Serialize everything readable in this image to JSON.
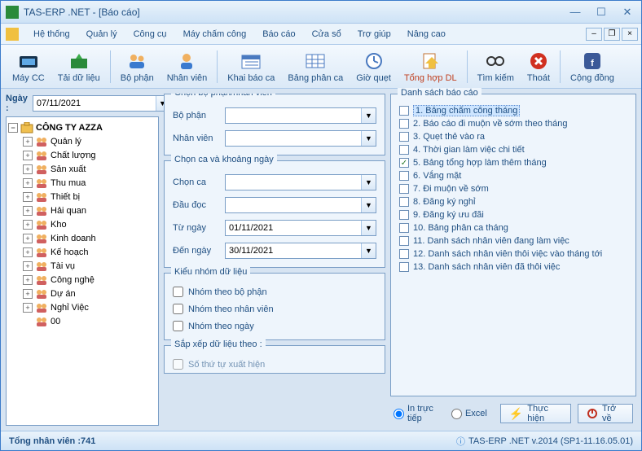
{
  "title": "TAS-ERP .NET - [Báo cáo]",
  "menu": {
    "items": [
      "Hệ thống",
      "Quản lý",
      "Công cụ",
      "Máy chấm công",
      "Báo cáo",
      "Cửa sổ",
      "Trợ giúp",
      "Nâng cao"
    ]
  },
  "toolbar": {
    "maycc": "Máy CC",
    "taidl": "Tải dữ liệu",
    "bophan": "Bộ phận",
    "nhanvien": "Nhân viên",
    "khaibaoca": "Khai báo ca",
    "bangphanca": "Bảng phân ca",
    "gioquet": "Giờ quẹt",
    "tonghop": "Tổng hợp DL",
    "timkiem": "Tìm kiếm",
    "thoat": "Thoát",
    "congdong": "Cộng đồng"
  },
  "leftDateLabel": "Ngày :",
  "leftDate": "07/11/2021",
  "tree": {
    "root": "CÔNG TY AZZA",
    "children": [
      "Quản lý",
      "Chất lượng",
      "Sản xuất",
      "Thu mua",
      "Thiết bị",
      "Hải quan",
      "Kho",
      "Kinh doanh",
      "Kế hoạch",
      "Tài vụ",
      "Công nghệ",
      "Dự án",
      "Nghỉ Việc",
      "00"
    ]
  },
  "gb1Title": "Chọn bộ phận/nhân viên",
  "gb1": {
    "bophanLabel": "Bộ phận",
    "nhanvienLabel": "Nhân viên",
    "bophan": "",
    "nhanvien": ""
  },
  "gb2Title": "Chọn ca  và khoảng ngày",
  "gb2": {
    "choncaLabel": "Chọn ca",
    "daudocLabel": "Đầu đọc",
    "tungayLabel": "Từ ngày",
    "denngayLabel": "Đến ngày",
    "chonca": "",
    "daudoc": "",
    "tungay": "01/11/2021",
    "denngay": "30/11/2021"
  },
  "gb3Title": "Kiểu nhóm dữ liệu",
  "gb3": {
    "nhomBP": "Nhóm theo bộ phận",
    "nhomNV": "Nhóm theo nhân viên",
    "nhomNgay": "Nhóm theo ngày"
  },
  "gb4Title": "Sắp xếp dữ liệu theo :",
  "gb4": {
    "sothutu": "Số thứ tự xuất hiện"
  },
  "gb5Title": "Danh sách báo cáo",
  "reports": [
    {
      "label": "1. Bảng chấm công tháng",
      "checked": false,
      "selected": true
    },
    {
      "label": "2. Báo cáo đi muộn về sớm theo tháng",
      "checked": false
    },
    {
      "label": "3. Quẹt thẻ vào ra",
      "checked": false
    },
    {
      "label": "4. Thời gian làm việc chi tiết",
      "checked": false
    },
    {
      "label": "5. Bảng tổng hợp làm thêm tháng",
      "checked": true
    },
    {
      "label": "6. Vắng mặt",
      "checked": false
    },
    {
      "label": "7. Đi muộn về sớm",
      "checked": false
    },
    {
      "label": "8. Đăng ký nghỉ",
      "checked": false
    },
    {
      "label": "9. Đăng ký ưu đãi",
      "checked": false
    },
    {
      "label": "10. Bảng phân ca tháng",
      "checked": false
    },
    {
      "label": "11. Danh sách nhân viên đang làm việc",
      "checked": false
    },
    {
      "label": "12. Danh sách nhân viên thôi việc vào tháng tới",
      "checked": false
    },
    {
      "label": "13. Danh sách nhân viên đã thôi việc",
      "checked": false
    }
  ],
  "radio": {
    "print": "In trực tiếp",
    "excel": "Excel"
  },
  "buttons": {
    "thuchien": "Thực hiện",
    "trove": "Trở về"
  },
  "status": {
    "left": "Tổng nhân viên :741",
    "right": "TAS-ERP .NET v.2014 (SP1-11.16.05.01)"
  }
}
